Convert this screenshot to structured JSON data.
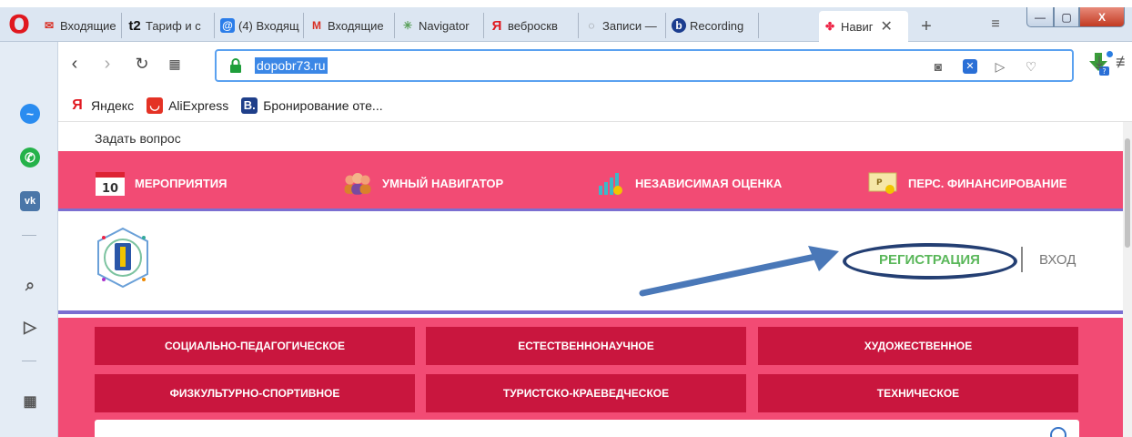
{
  "browser": {
    "tabs": [
      {
        "label": "Входящие",
        "icon": "gmail-icon",
        "color": "#d93025"
      },
      {
        "label": "Тариф и с",
        "icon": "t2-icon",
        "color": "#111111"
      },
      {
        "label": "(4) Входящ",
        "icon": "mail-at-icon",
        "color": "#2b7de9"
      },
      {
        "label": "Входящие",
        "icon": "gmail-icon",
        "color": "#d93025"
      },
      {
        "label": "Navigator",
        "icon": "navigator-icon",
        "color": "#5aa05a"
      },
      {
        "label": "веброскв",
        "icon": "yandex-icon",
        "color": "#e0181f"
      },
      {
        "label": "Записи —",
        "icon": "chat-icon",
        "color": "#666666"
      },
      {
        "label": "Recording",
        "icon": "recording-icon",
        "color": "#1b3d8f"
      },
      {
        "label": "Навиг",
        "icon": "navigator-flower-icon",
        "color": "#e24",
        "active": true
      }
    ],
    "address": {
      "url": "dopobr73.ru"
    },
    "bookmarks": [
      {
        "label": "Яндекс",
        "icon": "yandex-icon"
      },
      {
        "label": "AliExpress",
        "icon": "aliexpress-icon"
      },
      {
        "label": "Бронирование оте...",
        "icon": "booking-icon"
      }
    ]
  },
  "page": {
    "ask_question": "Задать вопрос",
    "calendar_day": "10",
    "top_nav": [
      {
        "label": "МЕРОПРИЯТИЯ",
        "icon": "calendar-icon"
      },
      {
        "label": "УМНЫЙ НАВИГАТОР",
        "icon": "people-icon"
      },
      {
        "label": "НЕЗАВИСИМАЯ ОЦЕНКА",
        "icon": "chart-icon"
      },
      {
        "label": "ПЕРС. ФИНАНСИРОВАНИЕ",
        "icon": "certificate-icon"
      }
    ],
    "register": "РЕГИСТРАЦИЯ",
    "login": "ВХОД",
    "directions": [
      "СОЦИАЛЬНО-ПЕДАГОГИЧЕСКОЕ",
      "ЕСТЕСТВЕННОНАУЧНОЕ",
      "ХУДОЖЕСТВЕННОЕ",
      "ФИЗКУЛЬТУРНО-СПОРТИВНОЕ",
      "ТУРИСТСКО-КРАЕВЕДЧЕСКОЕ",
      "ТЕХНИЧЕСКОЕ"
    ]
  },
  "colors": {
    "brand_pink": "#f24b74",
    "button_crimson": "#c9163e",
    "accent_purple": "#7b6fd1",
    "register_green": "#5ab75a",
    "annotation_navy": "#243f73"
  }
}
